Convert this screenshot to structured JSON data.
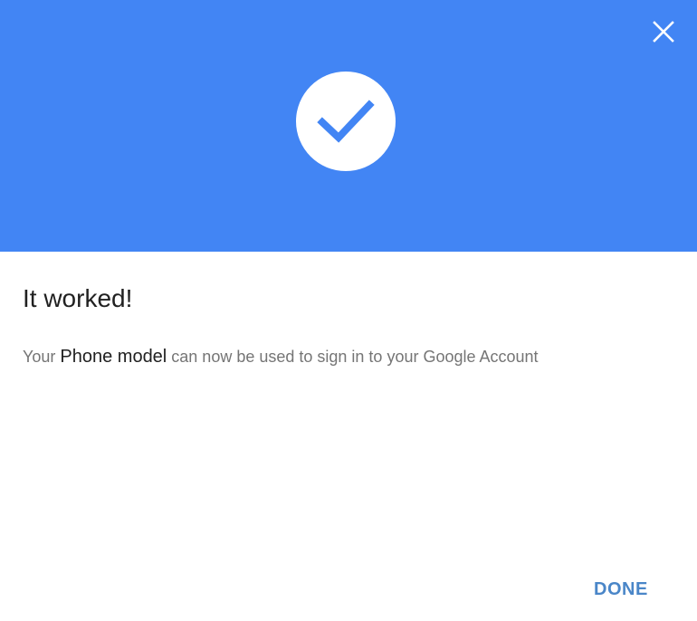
{
  "dialog": {
    "title": "It worked!",
    "message": {
      "prefix": "Your",
      "device_name": "Phone model",
      "suffix": "can now be used to sign in to your Google Account"
    },
    "done_label": "DONE"
  },
  "icons": {
    "close": "close-icon",
    "success": "check-icon"
  },
  "colors": {
    "banner": "#4285f4",
    "checkmark": "#4285f4",
    "accent_text": "#4a86c8",
    "title_text": "#212121",
    "body_text": "#757575"
  }
}
